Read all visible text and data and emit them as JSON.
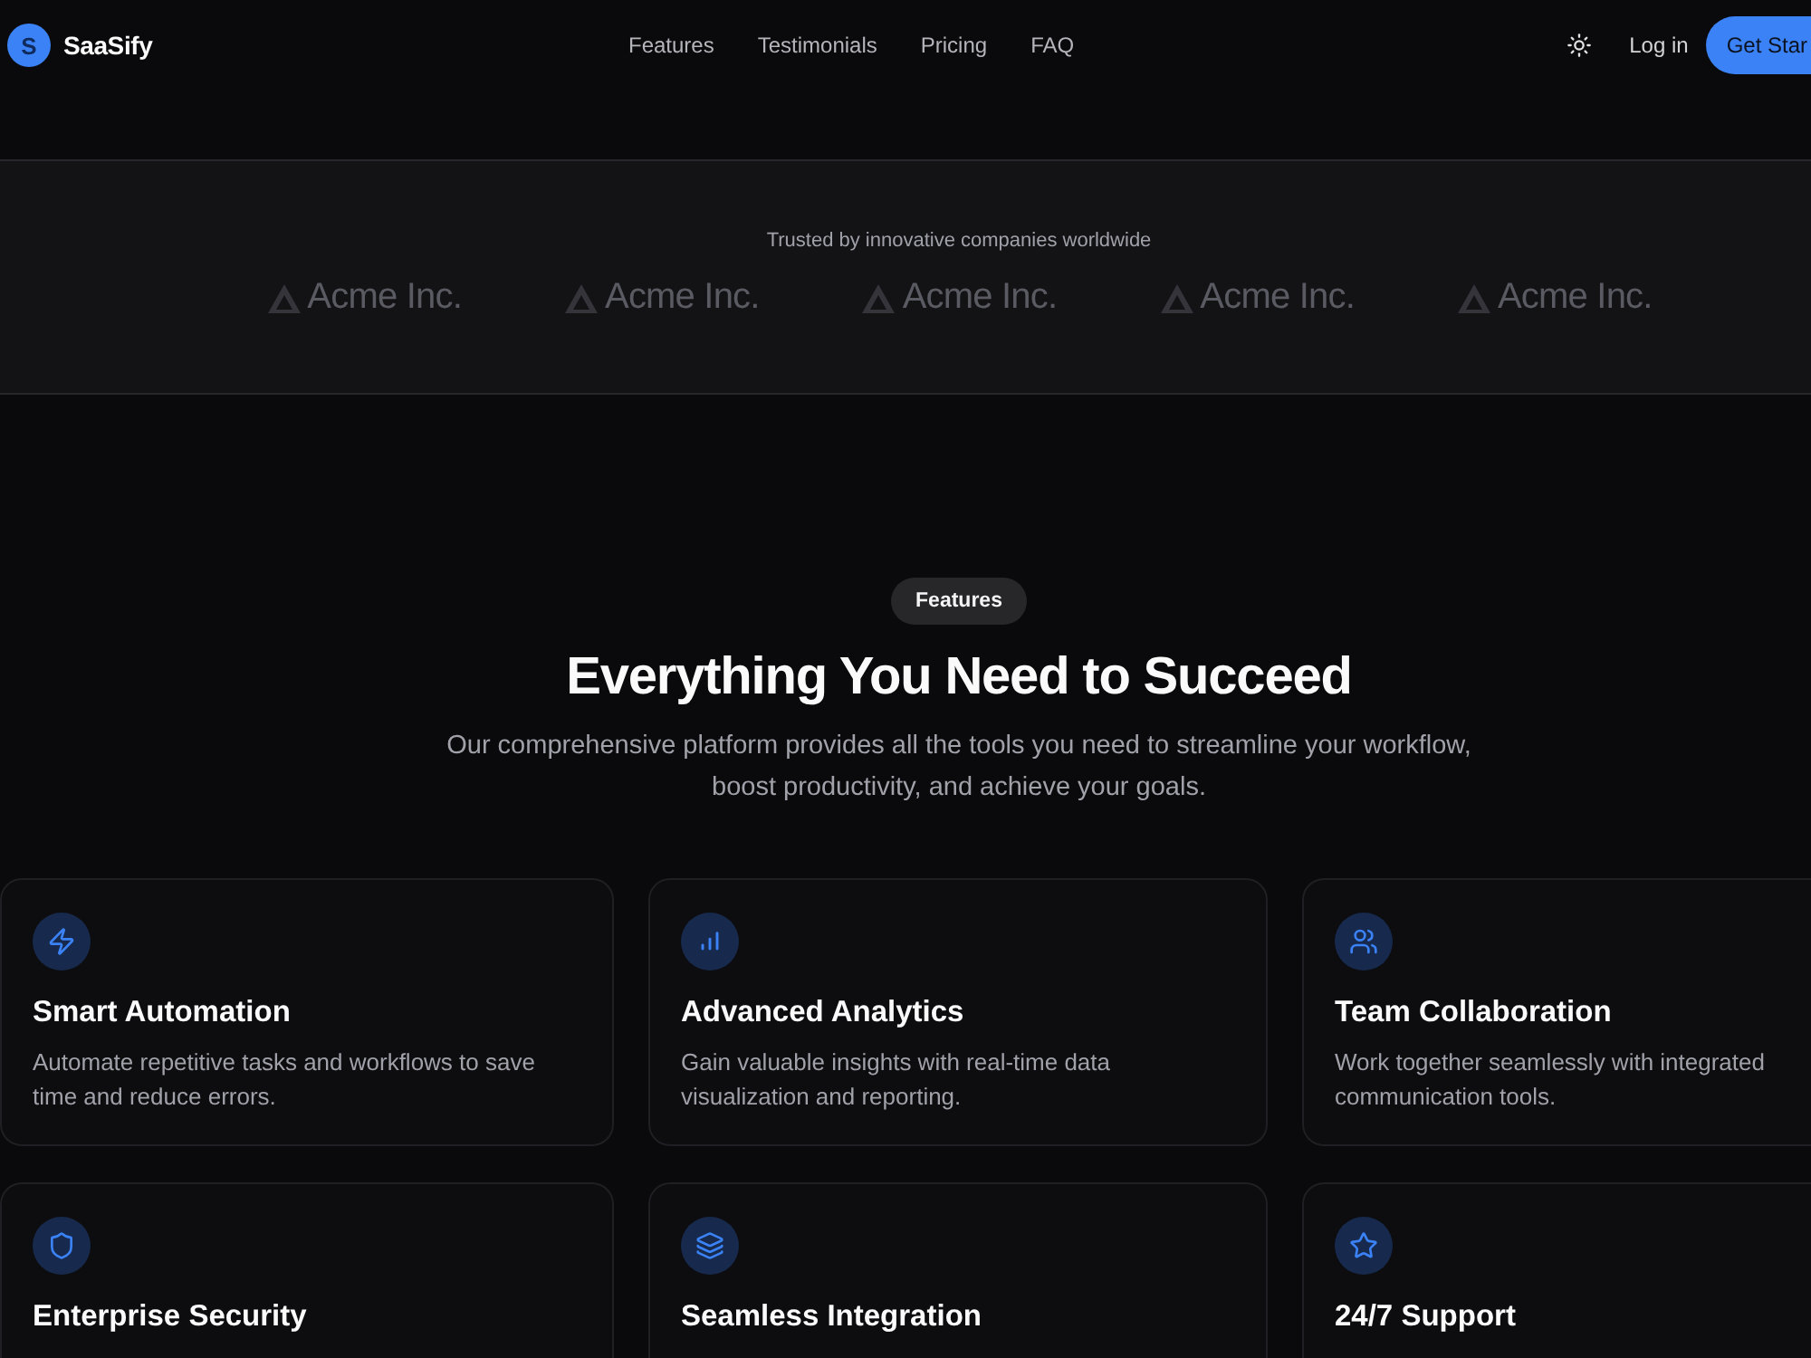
{
  "header": {
    "logo_mark": "S",
    "brand": "SaaSify",
    "nav": [
      {
        "label": "Features"
      },
      {
        "label": "Testimonials"
      },
      {
        "label": "Pricing"
      },
      {
        "label": "FAQ"
      }
    ],
    "login": "Log in",
    "cta": "Get Star"
  },
  "trusted": {
    "caption": "Trusted by innovative companies worldwide",
    "logos": [
      "Acme Inc.",
      "Acme Inc.",
      "Acme Inc.",
      "Acme Inc.",
      "Acme Inc."
    ]
  },
  "features": {
    "badge": "Features",
    "title": "Everything You Need to Succeed",
    "subtitle": "Our comprehensive platform provides all the tools you need to streamline your workflow, boost productivity, and achieve your goals.",
    "cards": [
      {
        "title": "Smart Automation",
        "description": "Automate repetitive tasks and workflows to save time and reduce errors."
      },
      {
        "title": "Advanced Analytics",
        "description": "Gain valuable insights with real-time data visualization and reporting."
      },
      {
        "title": "Team Collaboration",
        "description": "Work together seamlessly with integrated communication tools."
      },
      {
        "title": "Enterprise Security"
      },
      {
        "title": "Seamless Integration"
      },
      {
        "title": "24/7 Support"
      }
    ]
  }
}
